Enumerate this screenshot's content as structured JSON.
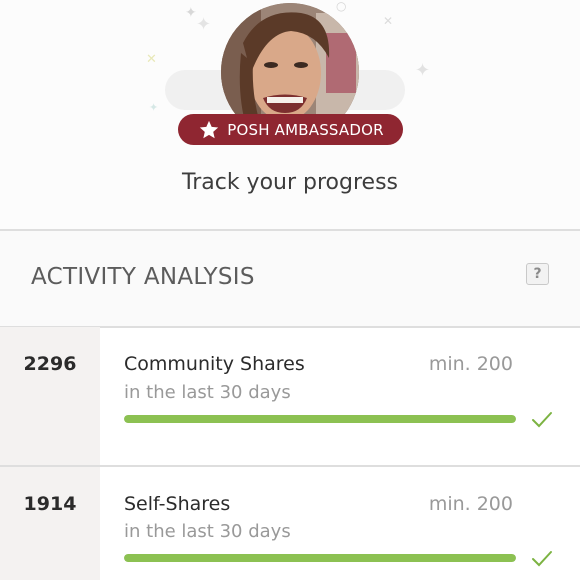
{
  "header": {
    "badge_label": "POSH AMBASSADOR",
    "title": "Track your progress"
  },
  "activity": {
    "section_title": "ACTIVITY ANALYSIS",
    "help_label": "?",
    "rows": [
      {
        "count": "2296",
        "label": "Community Shares",
        "subtitle": "in the last 30 days",
        "minimum": "min. 200",
        "progress": 1.0,
        "status": "check-icon"
      },
      {
        "count": "1914",
        "label": "Self-Shares",
        "subtitle": "in the last 30 days",
        "minimum": "min. 200",
        "progress": 1.0,
        "status": "check-icon"
      }
    ]
  },
  "colors": {
    "badge": "#8f2631",
    "progress": "#8cc152",
    "check": "#7cb342"
  }
}
